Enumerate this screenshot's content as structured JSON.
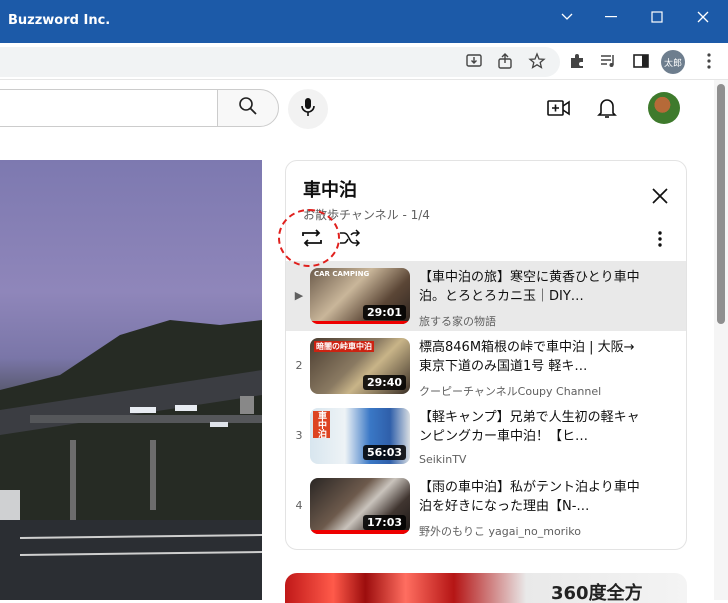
{
  "window": {
    "title": "Buzzword Inc."
  },
  "browser": {
    "profile_label": "太郎"
  },
  "playlist": {
    "title": "車中泊",
    "subtitle": "お散歩チャンネル - 1/4",
    "now_playing_marker": "▶",
    "items": [
      {
        "index": "",
        "title": "【車中泊の旅】寒空に黄香ひとり車中泊。とろとろカニ玉｜DIY…",
        "channel": "旅する家の物語",
        "duration": "29:01",
        "thumb_text": "CAR CAMPING"
      },
      {
        "index": "2",
        "title": "標高846M箱根の峠で車中泊 | 大阪→東京下道のみ国道1号 軽キ…",
        "channel": "クーピーチャンネルCoupy Channel",
        "duration": "29:40",
        "thumb_text": "暗闇の峠車中泊"
      },
      {
        "index": "3",
        "title": "【軽キャンプ】兄弟で人生初の軽キャンピングカー車中泊！【ヒ…",
        "channel": "SeikinTV",
        "duration": "56:03",
        "thumb_text": "車中泊"
      },
      {
        "index": "4",
        "title": "【雨の車中泊】私がテント泊より車中泊を好きになった理由【N-…",
        "channel": "野外のもりこ yagai_no_moriko",
        "duration": "17:03",
        "thumb_text": ""
      }
    ]
  },
  "next_card": {
    "text": "360度全方"
  },
  "colors": {
    "titlebar": "#1c5aa8",
    "highlight": "#e0201d",
    "active_row": "#e9e9e9"
  }
}
